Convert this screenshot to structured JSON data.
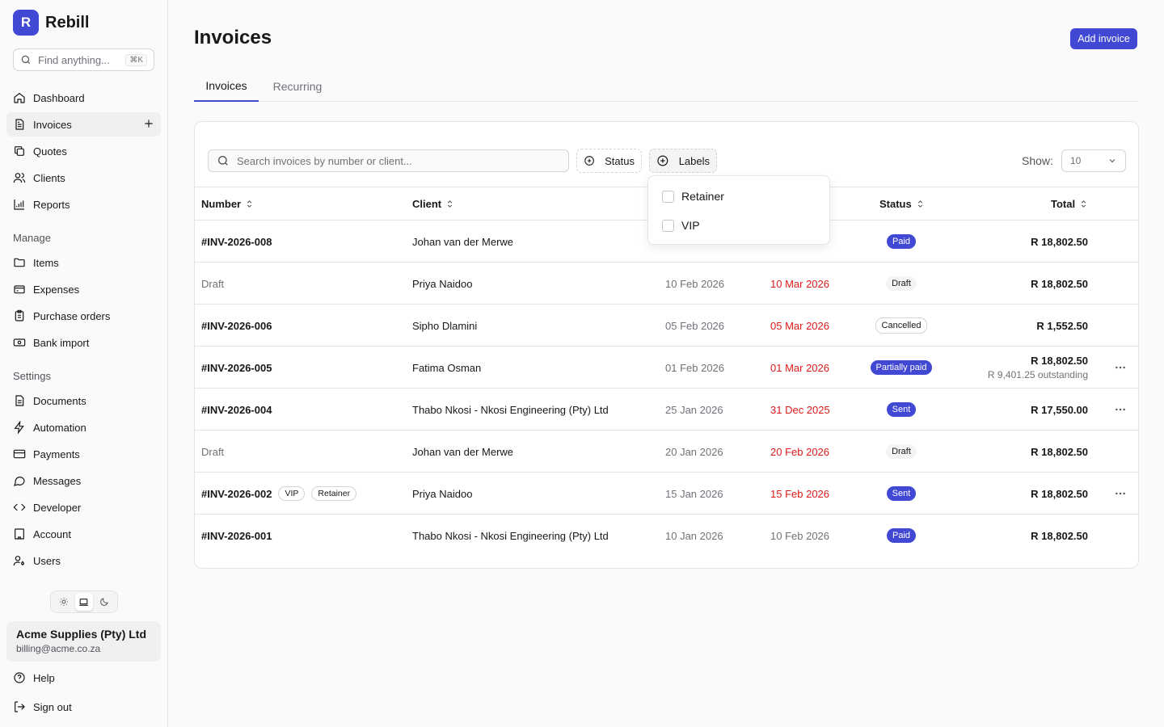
{
  "app": {
    "logo_letter": "R",
    "name": "Rebill"
  },
  "sidebar": {
    "search_placeholder": "Find anything...",
    "search_shortcut": "⌘K",
    "nav": [
      {
        "label": "Dashboard",
        "icon": "home-icon"
      },
      {
        "label": "Invoices",
        "icon": "document-icon",
        "active": true
      },
      {
        "label": "Quotes",
        "icon": "copy-icon"
      },
      {
        "label": "Clients",
        "icon": "users-icon"
      },
      {
        "label": "Reports",
        "icon": "chart-icon"
      }
    ],
    "manage_label": "Manage",
    "manage": [
      {
        "label": "Items",
        "icon": "folder-icon"
      },
      {
        "label": "Expenses",
        "icon": "wallet-icon"
      },
      {
        "label": "Purchase orders",
        "icon": "clipboard-icon"
      },
      {
        "label": "Bank import",
        "icon": "banknote-icon"
      }
    ],
    "settings_label": "Settings",
    "settings": [
      {
        "label": "Documents",
        "icon": "document-icon"
      },
      {
        "label": "Automation",
        "icon": "bolt-icon"
      },
      {
        "label": "Payments",
        "icon": "card-icon"
      },
      {
        "label": "Messages",
        "icon": "message-icon"
      },
      {
        "label": "Developer",
        "icon": "code-icon"
      },
      {
        "label": "Account",
        "icon": "building-icon"
      },
      {
        "label": "Users",
        "icon": "user-key-icon"
      }
    ],
    "org": {
      "name": "Acme Supplies (Pty) Ltd",
      "email": "billing@acme.co.za"
    },
    "help_label": "Help",
    "signout_label": "Sign out"
  },
  "main": {
    "title": "Invoices",
    "add_button": "Add invoice",
    "tabs": [
      {
        "label": "Invoices",
        "active": true
      },
      {
        "label": "Recurring"
      }
    ],
    "search_placeholder": "Search invoices by number or client...",
    "filters": {
      "status": "Status",
      "labels": "Labels"
    },
    "show_label": "Show:",
    "show_value": "10",
    "columns": {
      "number": "Number",
      "client": "Client",
      "status": "Status",
      "total": "Total"
    },
    "labels_dropdown": [
      "Retainer",
      "VIP"
    ],
    "rows": [
      {
        "number": "#INV-2026-008",
        "client": "Johan van der Merwe",
        "issued": "",
        "due": "",
        "overdue": false,
        "status": "Paid",
        "status_style": "blue",
        "total": "R 18,802.50",
        "outstanding": "",
        "more": false,
        "tags": []
      },
      {
        "number": "Draft",
        "draft": true,
        "client": "Priya Naidoo",
        "issued": "10 Feb 2026",
        "due": "10 Mar 2026",
        "overdue": true,
        "status": "Draft",
        "status_style": "grey",
        "total": "R 18,802.50",
        "outstanding": "",
        "more": false,
        "tags": []
      },
      {
        "number": "#INV-2026-006",
        "client": "Sipho Dlamini",
        "issued": "05 Feb 2026",
        "due": "05 Mar 2026",
        "overdue": true,
        "status": "Cancelled",
        "status_style": "outline",
        "total": "R 1,552.50",
        "outstanding": "",
        "more": false,
        "tags": []
      },
      {
        "number": "#INV-2026-005",
        "client": "Fatima Osman",
        "issued": "01 Feb 2026",
        "due": "01 Mar 2026",
        "overdue": true,
        "status": "Partially paid",
        "status_style": "blue",
        "total": "R 18,802.50",
        "outstanding": "R 9,401.25 outstanding",
        "more": true,
        "tags": []
      },
      {
        "number": "#INV-2026-004",
        "client": "Thabo Nkosi - Nkosi Engineering (Pty) Ltd",
        "issued": "25 Jan 2026",
        "due": "31 Dec 2025",
        "overdue": true,
        "status": "Sent",
        "status_style": "blue",
        "total": "R 17,550.00",
        "outstanding": "",
        "more": true,
        "tags": []
      },
      {
        "number": "Draft",
        "draft": true,
        "client": "Johan van der Merwe",
        "issued": "20 Jan 2026",
        "due": "20 Feb 2026",
        "overdue": true,
        "status": "Draft",
        "status_style": "grey",
        "total": "R 18,802.50",
        "outstanding": "",
        "more": false,
        "tags": []
      },
      {
        "number": "#INV-2026-002",
        "client": "Priya Naidoo",
        "issued": "15 Jan 2026",
        "due": "15 Feb 2026",
        "overdue": true,
        "status": "Sent",
        "status_style": "blue",
        "total": "R 18,802.50",
        "outstanding": "",
        "more": true,
        "tags": [
          "VIP",
          "Retainer"
        ]
      },
      {
        "number": "#INV-2026-001",
        "client": "Thabo Nkosi - Nkosi Engineering (Pty) Ltd",
        "issued": "10 Jan 2026",
        "due": "10 Feb 2026",
        "overdue": false,
        "status": "Paid",
        "status_style": "blue",
        "total": "R 18,802.50",
        "outstanding": "",
        "more": false,
        "tags": []
      }
    ]
  },
  "colors": {
    "accent": "#4048d4",
    "overdue": "#dc1a1a",
    "muted": "#71717a"
  }
}
